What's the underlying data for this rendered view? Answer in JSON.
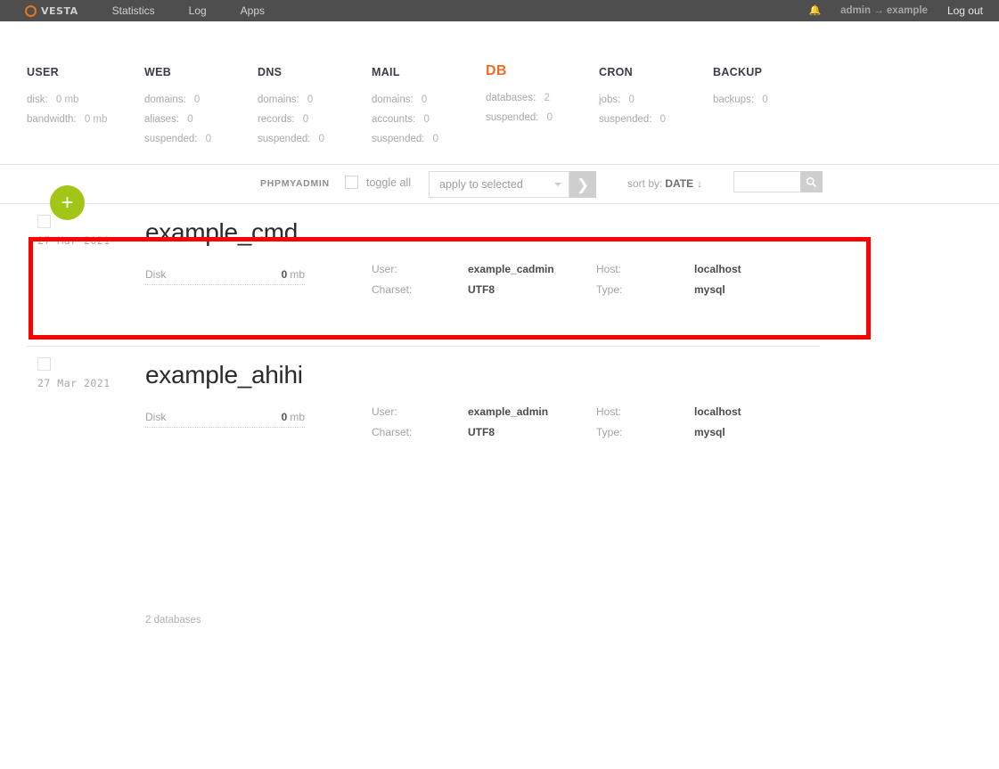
{
  "topbar": {
    "logo_text": "VESTA",
    "nav": [
      {
        "label": "Statistics"
      },
      {
        "label": "Log"
      },
      {
        "label": "Apps"
      }
    ],
    "bell_icon": "bell-icon",
    "user_context": "admin → example",
    "logout_label": "Log out"
  },
  "stats": [
    {
      "title": "USER",
      "active": false,
      "rows": [
        {
          "key": "disk:",
          "value": "0 mb"
        },
        {
          "key": "bandwidth:",
          "value": "0 mb"
        }
      ]
    },
    {
      "title": "WEB",
      "active": false,
      "rows": [
        {
          "key": "domains:",
          "value": "0"
        },
        {
          "key": "aliases:",
          "value": "0"
        },
        {
          "key": "suspended:",
          "value": "0"
        }
      ]
    },
    {
      "title": "DNS",
      "active": false,
      "rows": [
        {
          "key": "domains:",
          "value": "0"
        },
        {
          "key": "records:",
          "value": "0"
        },
        {
          "key": "suspended:",
          "value": "0"
        }
      ]
    },
    {
      "title": "MAIL",
      "active": false,
      "rows": [
        {
          "key": "domains:",
          "value": "0"
        },
        {
          "key": "accounts:",
          "value": "0"
        },
        {
          "key": "suspended:",
          "value": "0"
        }
      ]
    },
    {
      "title": "DB",
      "active": true,
      "rows": [
        {
          "key": "databases:",
          "value": "2"
        },
        {
          "key": "suspended:",
          "value": "0"
        }
      ]
    },
    {
      "title": "CRON",
      "active": false,
      "rows": [
        {
          "key": "jobs:",
          "value": "0"
        },
        {
          "key": "suspended:",
          "value": "0"
        }
      ]
    },
    {
      "title": "BACKUP",
      "active": false,
      "rows": [
        {
          "key": "backups:",
          "value": "0"
        }
      ]
    }
  ],
  "toolbar": {
    "phpmyadmin_label": "PHPMYADMIN",
    "toggle_all_label": "toggle all",
    "apply_selected_value": "apply to selected",
    "go_icon": "chevron-right-icon",
    "sort_by_label": "sort by:",
    "sort_by_value": "DATE",
    "sort_direction_icon": "↓",
    "search_value": "",
    "search_placeholder": "",
    "search_icon": "search-icon"
  },
  "add_button": {
    "icon": "plus-icon",
    "label": "+"
  },
  "databases": [
    {
      "date": "27 Mar 2021",
      "name": "example_cmd",
      "disk_label": "Disk",
      "disk_value": "0",
      "disk_unit": "mb",
      "user_label": "User:",
      "user_value": "example_cadmin",
      "host_label": "Host:",
      "host_value": "localhost",
      "charset_label": "Charset:",
      "charset_value": "UTF8",
      "type_label": "Type:",
      "type_value": "mysql"
    },
    {
      "date": "27 Mar 2021",
      "name": "example_ahihi",
      "disk_label": "Disk",
      "disk_value": "0",
      "disk_unit": "mb",
      "user_label": "User:",
      "user_value": "example_admin",
      "host_label": "Host:",
      "host_value": "localhost",
      "charset_label": "Charset:",
      "charset_value": "UTF8",
      "type_label": "Type:",
      "type_value": "mysql"
    }
  ],
  "footer": {
    "count_label": "2 databases"
  },
  "colors": {
    "topbar_bg": "#4e4e4e",
    "brand_orange": "#e8761a",
    "active_tab": "#f4592c",
    "add_button_green": "#a2c617",
    "highlight_red": "#fe0000"
  }
}
